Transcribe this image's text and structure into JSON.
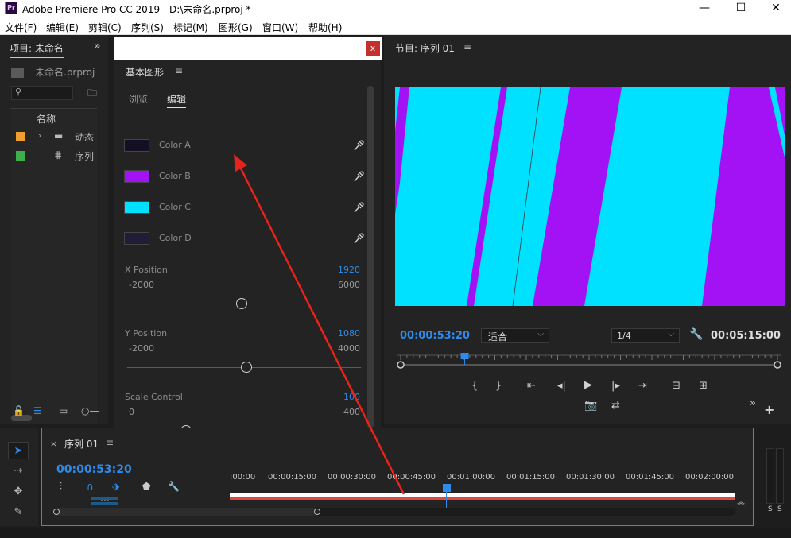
{
  "window": {
    "app_icon": "Pr",
    "title": "Adobe Premiere Pro CC 2019 - D:\\未命名.prproj *",
    "minimize_icon": "minimize-icon",
    "maximize_icon": "maximize-icon",
    "close_icon": "close-icon"
  },
  "menu": [
    "文件(F)",
    "编辑(E)",
    "剪辑(C)",
    "序列(S)",
    "标记(M)",
    "图形(G)",
    "窗口(W)",
    "帮助(H)"
  ],
  "project": {
    "tab": "项目: 未命名",
    "file": "未命名.prproj",
    "column_name": "名称",
    "items": [
      {
        "label": "动态",
        "color": "#f0a030",
        "icon": "folder-icon"
      },
      {
        "label": "序列",
        "color": "#3cb04a",
        "icon": "sequence-icon"
      }
    ]
  },
  "essential_graphics": {
    "close": "x",
    "title": "基本图形",
    "tabs": {
      "browse": "浏览",
      "edit": "编辑"
    },
    "colors": [
      {
        "label": "Color A",
        "value": "#150f24"
      },
      {
        "label": "Color B",
        "value": "#a212f5"
      },
      {
        "label": "Color C",
        "value": "#00e0ff"
      },
      {
        "label": "Color D",
        "value": "#221c36"
      }
    ],
    "props": [
      {
        "label": "X Position",
        "value": "1920",
        "min": "-2000",
        "max": "6000",
        "fraction": 0.49
      },
      {
        "label": "Y Position",
        "value": "1080",
        "min": "-2000",
        "max": "4000",
        "fraction": 0.51
      },
      {
        "label": "Scale Control",
        "value": "100",
        "min": "0",
        "max": "400",
        "fraction": 0.25
      }
    ]
  },
  "program": {
    "title": "节目: 序列 01",
    "timecode": "00:00:53:20",
    "fit": "适合",
    "resolution": "1/4",
    "duration": "00:05:15:00",
    "playhead_fraction": 0.17,
    "video_colors": {
      "background": "#00e0ff",
      "stripe": "#a212f5"
    }
  },
  "timeline": {
    "sequence": "序列 01",
    "timecode": "00:00:53:20",
    "ticks": [
      ":00:00",
      "00:00:15:00",
      "00:00:30:00",
      "00:00:45:00",
      "00:01:00:00",
      "00:01:15:00",
      "00:01:30:00",
      "00:01:45:00",
      "00:02:00:00"
    ]
  },
  "meters": {
    "left": "S",
    "right": "S"
  },
  "accent": "#2d8ceb",
  "annotation_arrow_color": "#e8231c"
}
